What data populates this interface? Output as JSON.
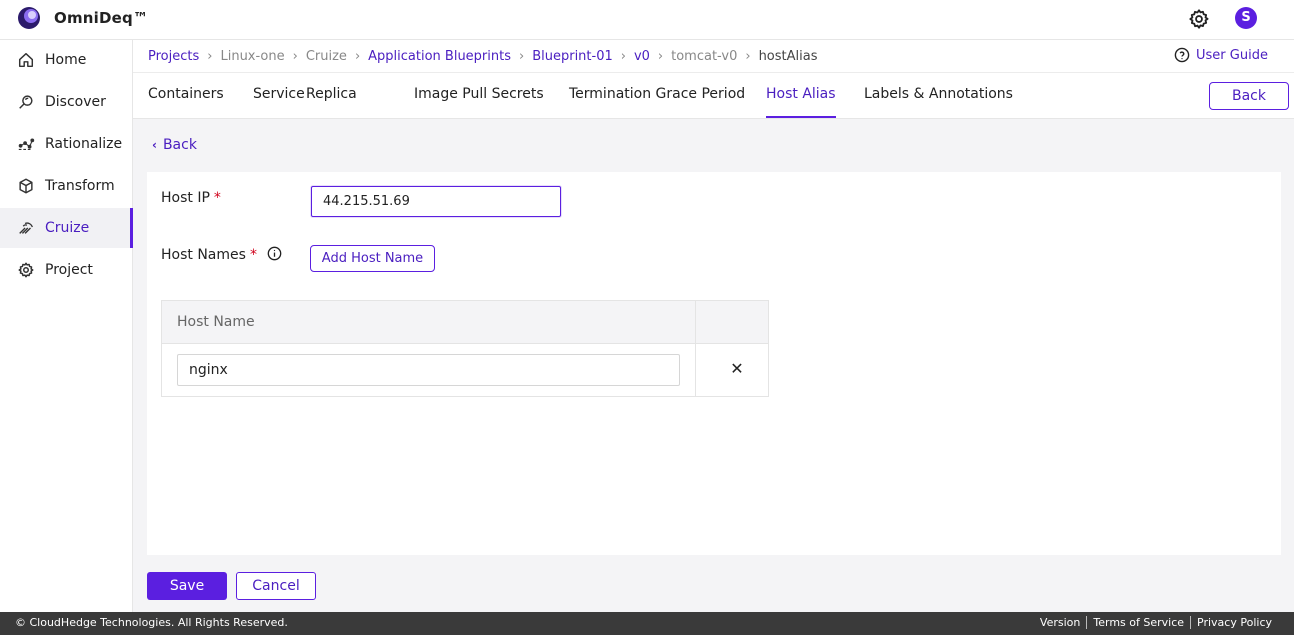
{
  "app": {
    "title": "OmniDeq™",
    "avatar_initial": "S"
  },
  "sidebar": {
    "items": [
      {
        "label": "Home",
        "icon": "home-icon"
      },
      {
        "label": "Discover",
        "icon": "discover-icon"
      },
      {
        "label": "Rationalize",
        "icon": "rationalize-icon"
      },
      {
        "label": "Transform",
        "icon": "cube-icon"
      },
      {
        "label": "Cruize",
        "icon": "cruize-icon",
        "active": true
      },
      {
        "label": "Project",
        "icon": "gear-icon"
      }
    ]
  },
  "breadcrumb": {
    "items": [
      "Projects",
      "Linux-one",
      "Cruize",
      "Application Blueprints",
      "Blueprint-01",
      "v0",
      "tomcat-v0",
      "hostAlias"
    ]
  },
  "user_guide": "User Guide",
  "tabs": [
    "Containers",
    "Service",
    "Replica",
    "Image Pull Secrets",
    "Termination Grace Period",
    "Host Alias",
    "Labels & Annotations"
  ],
  "active_tab": "Host Alias",
  "header_back": "Back",
  "back_link": "Back",
  "form": {
    "host_ip_label": "Host IP",
    "host_ip_value": "44.215.51.69",
    "host_names_label": "Host Names",
    "required_mark": "*",
    "add_host_name": "Add Host Name",
    "table": {
      "header": "Host Name",
      "rows": [
        {
          "value": "nginx",
          "remove": "✕"
        }
      ]
    }
  },
  "actions": {
    "save": "Save",
    "cancel": "Cancel"
  },
  "footer": {
    "copyright": "© CloudHedge Technologies. All Rights Reserved.",
    "links": [
      "Version",
      "Terms of Service",
      "Privacy Policy"
    ]
  },
  "colors": {
    "accent": "#5b1fe0",
    "footer_bg": "#3a3a3a"
  }
}
